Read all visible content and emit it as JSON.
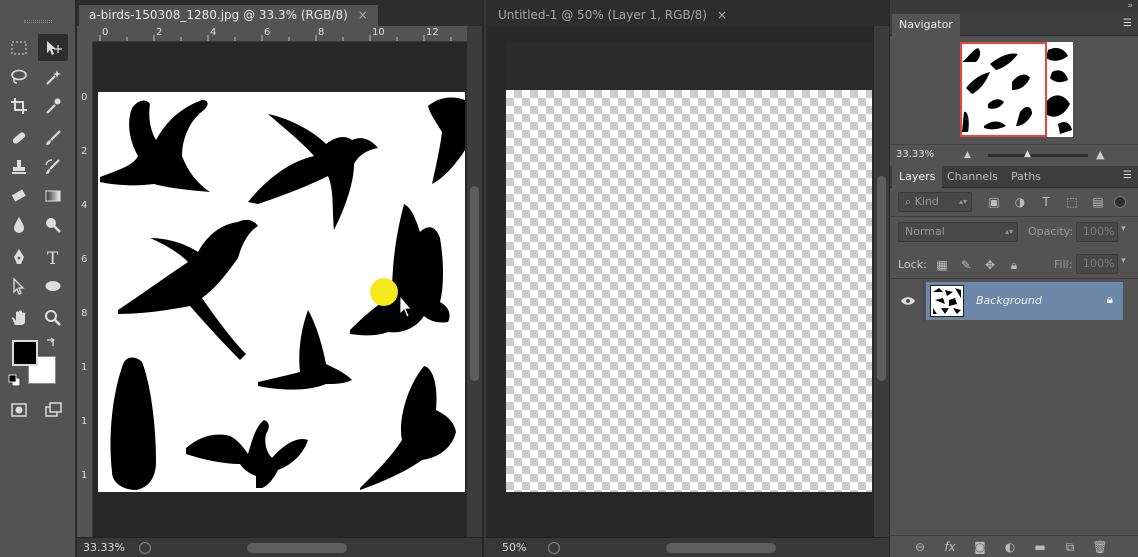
{
  "document_left": {
    "tab_title": "a-birds-150308_1280.jpg @ 33.3% (RGB/8)",
    "close_glyph": "×",
    "zoom": "33.33%",
    "ruler_h": [
      "0",
      "2",
      "4",
      "6",
      "8",
      "10",
      "12"
    ],
    "ruler_v": [
      "0",
      "2",
      "4",
      "6",
      "8",
      "1",
      "1",
      "1"
    ]
  },
  "document_right": {
    "tab_title": "Untitled-1 @ 50% (Layer 1, RGB/8)",
    "close_glyph": "×",
    "zoom": "50%"
  },
  "navigator": {
    "title": "Navigator",
    "zoom": "33.33%"
  },
  "layers_panel": {
    "tabs": [
      "Layers",
      "Channels",
      "Paths"
    ],
    "kind_label": "Kind",
    "blend_mode": "Normal",
    "opacity_label": "Opacity:",
    "opacity_value": "100%",
    "lock_label": "Lock:",
    "fill_label": "Fill:",
    "fill_value": "100%",
    "layers": [
      {
        "name": "Background",
        "visible": true,
        "locked": true
      }
    ]
  },
  "colors": {
    "foreground": "#000000",
    "background": "#ffffff",
    "selected_layer": "#6d87a8",
    "cursor_highlight": "#f5e81c",
    "navigator_view_box": "#e8463c"
  }
}
